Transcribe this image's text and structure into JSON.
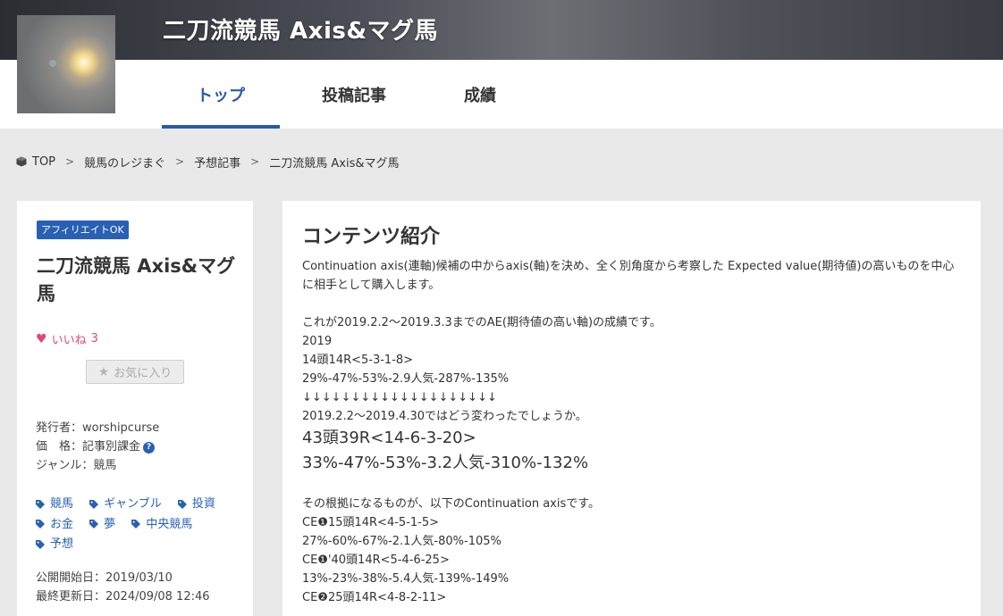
{
  "header": {
    "site_title": "二刀流競馬 Axis&マグ馬"
  },
  "nav": {
    "tabs": [
      {
        "label": "トップ",
        "active": true
      },
      {
        "label": "投稿記事",
        "active": false
      },
      {
        "label": "成績",
        "active": false
      }
    ]
  },
  "breadcrumb": [
    "TOP",
    "競馬のレジまぐ",
    "予想記事",
    "二刀流競馬 Axis&マグ馬"
  ],
  "sidebar": {
    "badge": "アフィリエイトOK",
    "title": "二刀流競馬 Axis&マグ馬",
    "like_label": "いいね",
    "like_count": "3",
    "favorite_label": "お気に入り",
    "publisher": "発行者：worshipcurse",
    "price": "価　格：記事別課金",
    "genre": "ジャンル：競馬",
    "tags": [
      "競馬",
      "ギャンブル",
      "投資",
      "お金",
      "夢",
      "中央競馬",
      "予想"
    ],
    "start_date": "公開開始日：2019/03/10",
    "updated_date": "最終更新日：2024/09/08 12:46"
  },
  "main": {
    "heading": "コンテンツ紹介",
    "lines": [
      "Continuation axis(連軸)候補の中からaxis(軸)を決め、全く別角度から考察した Expected value(期待値)の高いものを中心",
      "に相手として購入します。",
      "",
      "これが2019.2.2～2019.3.3までのAE(期待値の高い軸)の成績です。",
      "2019",
      "14頭14R<5-3-1-8>",
      "29%-47%-53%-2.9人気-287%-135%",
      "↓↓↓↓↓↓↓↓↓↓↓↓↓↓↓↓↓↓↓↓",
      "2019.2.2～2019.4.30ではどう変わったでしょうか。",
      "43頭39R<14-6-3-20>",
      "33%-47%-53%-3.2人気-310%-132%",
      "",
      "その根拠になるものが、以下のContinuation axisです。",
      "CE❶15頭14R<4-5-1-5>",
      "27%-60%-67%-2.1人気-80%-105%",
      "CE❶'40頭14R<5-4-6-25>",
      "13%-23%-38%-5.4人気-139%-149%",
      "CE❷25頭14R<4-8-2-11>"
    ]
  },
  "colors": {
    "accent": "#2a5aa8",
    "like": "#e0487a",
    "background": "#e9e9e9"
  }
}
